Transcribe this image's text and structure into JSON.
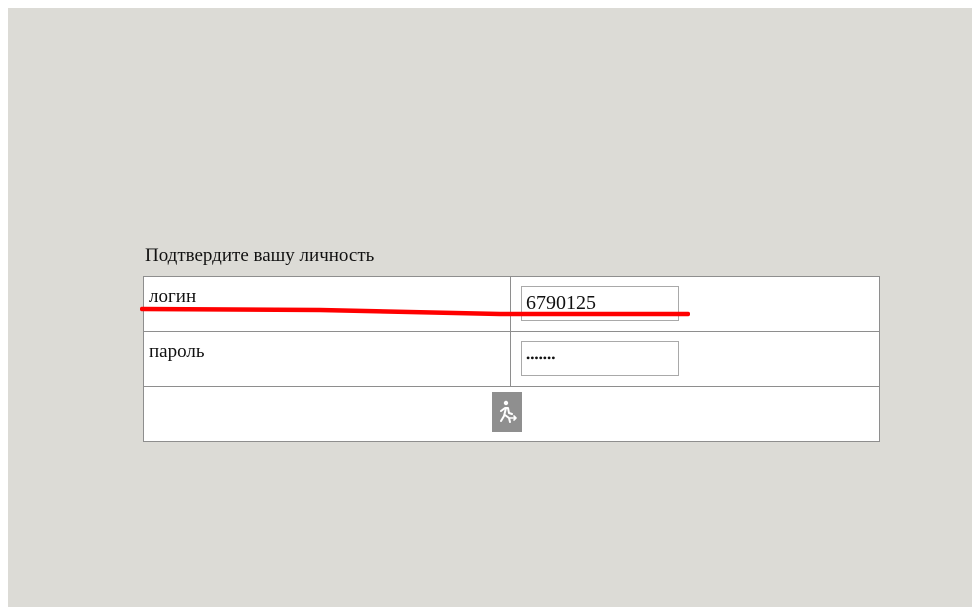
{
  "form": {
    "caption": "Подтвердите вашу личность",
    "login_label": "логин",
    "login_value": "6790125",
    "password_label": "пароль",
    "password_value": "•••••••"
  },
  "submit": {
    "icon": "walking-person-exit-icon"
  },
  "annotation": {
    "color": "#ff0000"
  }
}
